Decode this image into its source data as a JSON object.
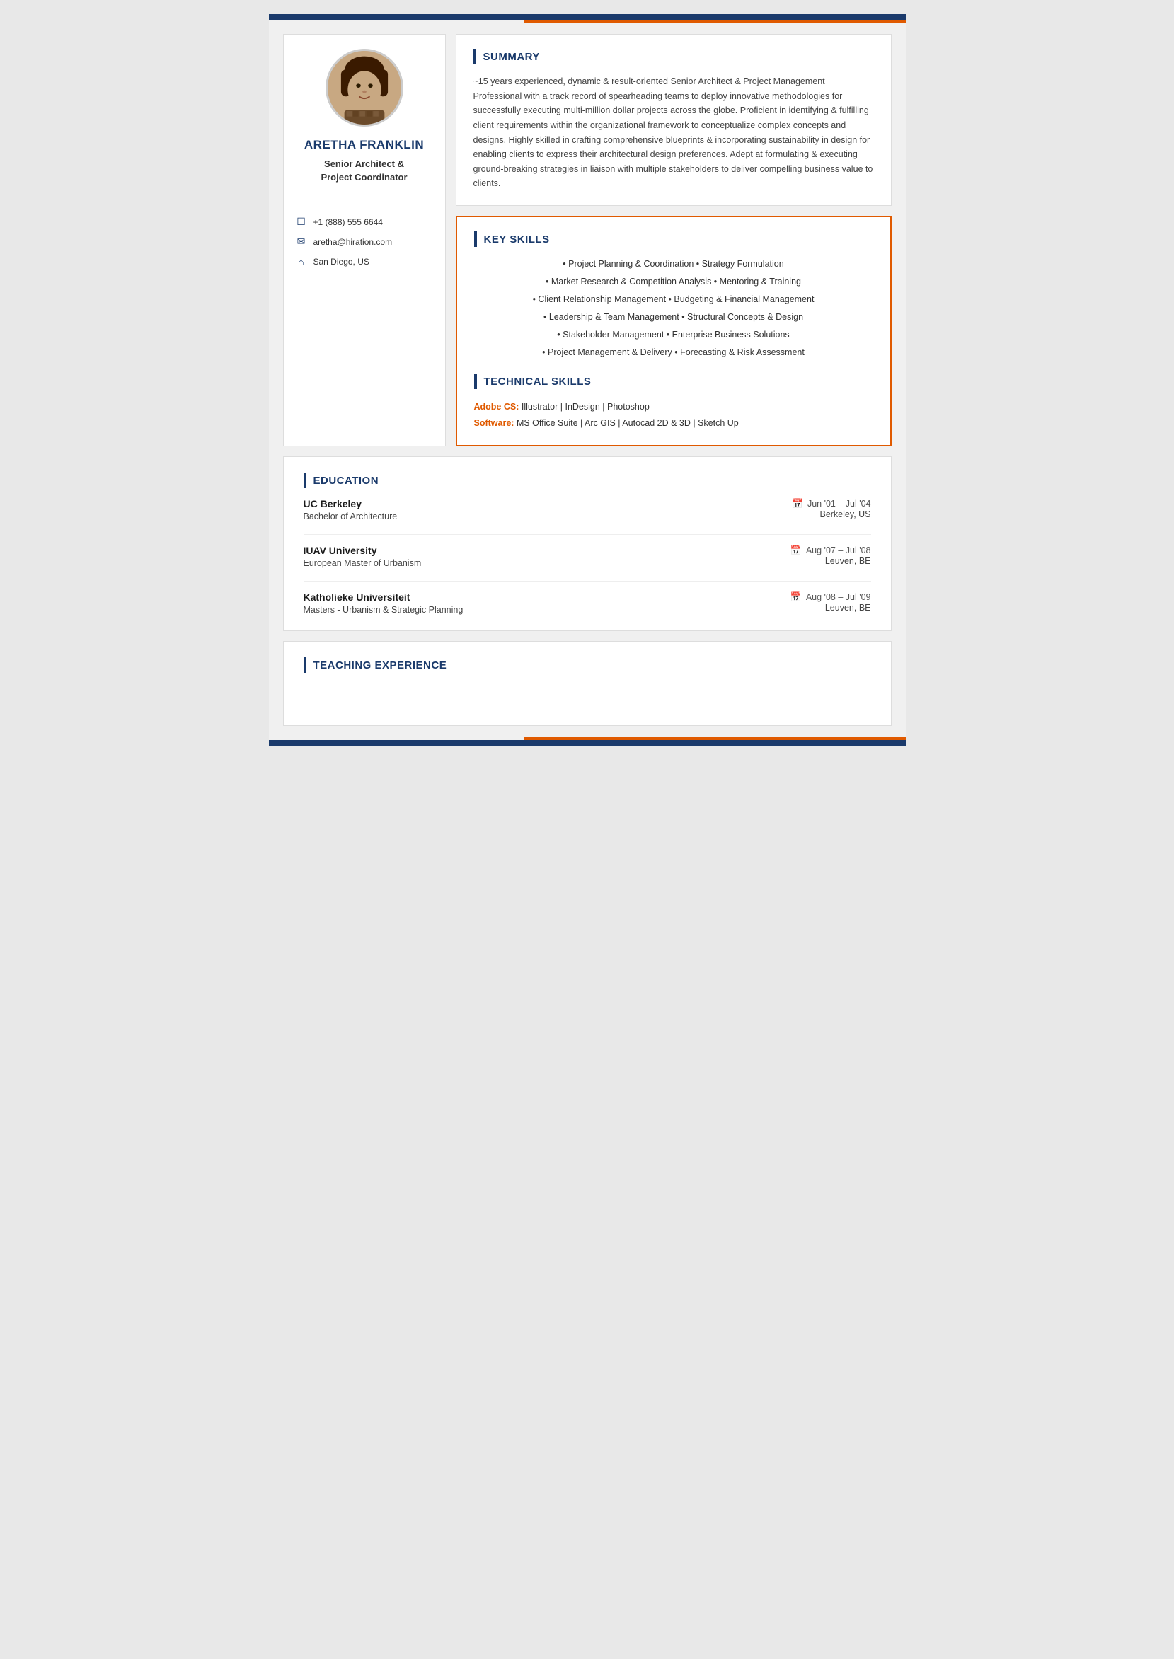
{
  "page": {
    "topBar": "top-bar",
    "accentBar": "accent-bar"
  },
  "sidebar": {
    "name": "ARETHA FRANKLiN",
    "title_line1": "Senior Architect &",
    "title_line2": "Project Coordinator",
    "contact": {
      "phone": "+1 (888) 555 6644",
      "email": "aretha@hiration.com",
      "location": "San Diego, US"
    }
  },
  "summary": {
    "section_title": "SUMMARY",
    "text": "~15 years experienced, dynamic & result-oriented Senior Architect & Project Management Professional with a track record of spearheading teams to deploy innovative methodologies for successfully executing multi-million dollar projects across the globe. Proficient in identifying & fulfilling client requirements within the organizational framework to conceptualize complex concepts and designs. Highly skilled in crafting comprehensive blueprints & incorporating sustainability in design for enabling clients to express their architectural design preferences. Adept at formulating & executing ground-breaking strategies in liaison with multiple stakeholders to deliver compelling business value to clients."
  },
  "key_skills": {
    "section_title": "KEY SKILLS",
    "rows": [
      "• Project Planning & Coordination • Strategy Formulation",
      "• Market Research & Competition Analysis • Mentoring & Training",
      "• Client Relationship Management • Budgeting & Financial Management",
      "• Leadership & Team Management • Structural Concepts & Design",
      "• Stakeholder Management • Enterprise Business Solutions",
      "• Project Management & Delivery • Forecasting & Risk Assessment"
    ]
  },
  "technical_skills": {
    "section_title": "TECHNICAL SKILLS",
    "items": [
      {
        "label": "Adobe CS:",
        "text": " Illustrator | InDesign | Photoshop"
      },
      {
        "label": "Software:",
        "text": " MS Office Suite | Arc GIS | Autocad 2D & 3D | Sketch Up"
      }
    ]
  },
  "education": {
    "section_title": "EDUCATION",
    "entries": [
      {
        "institution": "UC Berkeley",
        "date": "Jun '01 – Jul '04",
        "degree": "Bachelor of Architecture",
        "location": "Berkeley, US"
      },
      {
        "institution": "IUAV University",
        "date": "Aug '07 – Jul '08",
        "degree": "European Master of Urbanism",
        "location": "Leuven, BE"
      },
      {
        "institution": "Katholieke Universiteit",
        "date": "Aug '08 – Jul '09",
        "degree": "Masters - Urbanism & Strategic Planning",
        "location": "Leuven, BE"
      }
    ]
  },
  "teaching_experience": {
    "section_title": "TEACHING EXPERIENCE"
  }
}
